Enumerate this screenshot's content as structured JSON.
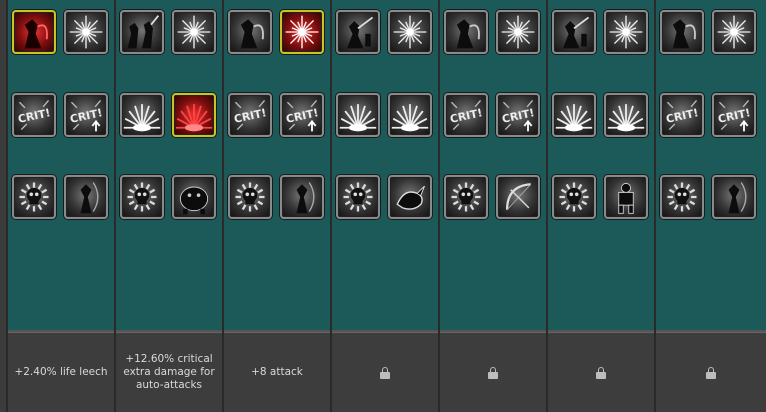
{
  "columns": [
    {
      "bonus": "+2.40% life leech",
      "rows": [
        [
          {
            "icon": "blood-mage-icon",
            "selected": true,
            "red": true
          },
          {
            "icon": "starburst-icon"
          }
        ],
        [
          {
            "icon": "crit-icon"
          },
          {
            "icon": "crit-up-icon"
          }
        ],
        [
          {
            "icon": "skull-burst-icon"
          },
          {
            "icon": "archer-icon"
          }
        ]
      ]
    },
    {
      "bonus": "+12.60% critical extra damage for auto-attacks",
      "rows": [
        [
          {
            "icon": "warriors-icon"
          },
          {
            "icon": "starburst-icon"
          }
        ],
        [
          {
            "icon": "explosion-icon"
          },
          {
            "icon": "red-impact-icon",
            "selected": true,
            "red": true
          }
        ],
        [
          {
            "icon": "skull-burst-icon"
          },
          {
            "icon": "beast-icon"
          }
        ]
      ]
    },
    {
      "bonus": "+8 attack",
      "rows": [
        [
          {
            "icon": "reaper-icon"
          },
          {
            "icon": "red-starburst-icon",
            "selected": true,
            "red": true
          }
        ],
        [
          {
            "icon": "crit-icon"
          },
          {
            "icon": "crit-up-icon"
          }
        ],
        [
          {
            "icon": "skull-burst-icon"
          },
          {
            "icon": "archer-icon"
          }
        ]
      ]
    },
    {
      "bonus": "",
      "locked": true,
      "rows": [
        [
          {
            "icon": "swordsman-icon"
          },
          {
            "icon": "starburst-icon"
          }
        ],
        [
          {
            "icon": "explosion-icon"
          },
          {
            "icon": "impact-icon"
          }
        ],
        [
          {
            "icon": "skull-burst-icon"
          },
          {
            "icon": "dragon-icon"
          }
        ]
      ]
    },
    {
      "bonus": "",
      "locked": true,
      "rows": [
        [
          {
            "icon": "reaper-icon"
          },
          {
            "icon": "starburst-icon"
          }
        ],
        [
          {
            "icon": "crit-icon"
          },
          {
            "icon": "crit-up-icon"
          }
        ],
        [
          {
            "icon": "skull-burst-icon"
          },
          {
            "icon": "bow-icon"
          }
        ]
      ]
    },
    {
      "bonus": "",
      "locked": true,
      "rows": [
        [
          {
            "icon": "swordsman-icon"
          },
          {
            "icon": "starburst-icon"
          }
        ],
        [
          {
            "icon": "explosion-icon"
          },
          {
            "icon": "impact-icon"
          }
        ],
        [
          {
            "icon": "skull-burst-icon"
          },
          {
            "icon": "golem-icon"
          }
        ]
      ]
    },
    {
      "bonus": "",
      "locked": true,
      "rows": [
        [
          {
            "icon": "reaper-icon"
          },
          {
            "icon": "starburst-icon"
          }
        ],
        [
          {
            "icon": "crit-icon"
          },
          {
            "icon": "crit-up-icon"
          }
        ],
        [
          {
            "icon": "skull-burst-icon"
          },
          {
            "icon": "archer-icon"
          }
        ]
      ]
    }
  ],
  "crit_text": "CRIT!",
  "colors": {
    "panel": "#1b5a58",
    "selected_border": "#c9c421",
    "footer": "#3d3d3d"
  }
}
